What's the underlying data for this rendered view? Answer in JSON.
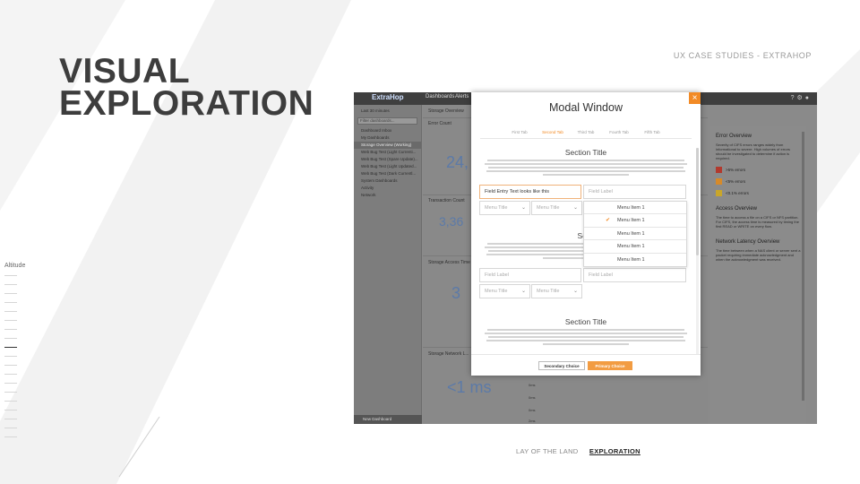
{
  "slide": {
    "title_line1": "VISUAL",
    "title_line2": "EXPLORATION",
    "kicker": "UX CASE STUDIES - EXTRAHOP",
    "altitude_label": "Altitude",
    "altitude_level": "11 of 19",
    "nav": {
      "item1": "LAY OF THE LAND",
      "item2": "EXPLORATION"
    }
  },
  "app": {
    "brand": "ExtraHop",
    "top_tabs": [
      "Dashboards",
      "Alerts"
    ],
    "sidebar": {
      "time_range": "Last 30 minutes",
      "filter_placeholder": "Filter dashboards...",
      "items": [
        "Dashboard Inbox",
        "My Dashboards",
        "Storage Overview (Working)",
        "Web Bug Test (Light Currenti...",
        "Web Bug Test (Spare Update)...",
        "Web Bug Test (Light Updated...",
        "Web Bug Test (Dark Currentl...",
        "System Dashboards",
        "Activity",
        "Network"
      ],
      "footer": "New Dashboard"
    },
    "main": {
      "header": "Storage Overview",
      "panels": [
        {
          "label": "Error Count",
          "value": "24,"
        },
        {
          "label": "Transaction Count",
          "value": "3,36"
        },
        {
          "label": "Storage Access Time",
          "value": "3"
        },
        {
          "label": "Storage Network L...",
          "value": "<1 ms"
        }
      ],
      "ms_labels": [
        "0ms",
        "0ms",
        "0ms",
        "2ms"
      ]
    },
    "right_panel": {
      "error_heading": "Error Overview",
      "error_text": "Severity of CIFS errors ranges widely from informational to severe. High volumes of errors should be investigated to determine if action is required.",
      "legend": [
        {
          "label": ">5% errors",
          "color": "#b23a2e"
        },
        {
          "label": "<5% errors",
          "color": "#d68a2a"
        },
        {
          "label": "<0.1% errors",
          "color": "#c9a62a"
        }
      ],
      "access_heading": "Access Overview",
      "access_text": "The time to access a file on a CIFS or NFS partition. For CIFS, the access time is measured by timing the first READ or WRITE on every flow.",
      "latency_heading": "Network Latency Overview",
      "latency_text": "The time between when a NAS client or server sent a packet requiring immediate acknowledgment and when the acknowledgment was received."
    }
  },
  "modal": {
    "title": "Modal Window",
    "tabs": [
      "First Tab",
      "Second Tab",
      "Third Tab",
      "Fourth Tab",
      "Fifth Tab"
    ],
    "active_tab": "Second Tab",
    "section_title": "Section Title",
    "section2_title": "Secti",
    "field_text": "Field Entry Text looks like this",
    "field_label": "Field Label",
    "menu_title": "Menu Title",
    "menu_items": [
      "Menu Item 1",
      "Menu Item 1",
      "Menu Item 1",
      "Menu Item 1",
      "Menu Item 1"
    ],
    "checked_index": 1,
    "secondary_btn": "Secondary Choice",
    "primary_btn": "Primary Choice",
    "accent": "#f28a25"
  }
}
